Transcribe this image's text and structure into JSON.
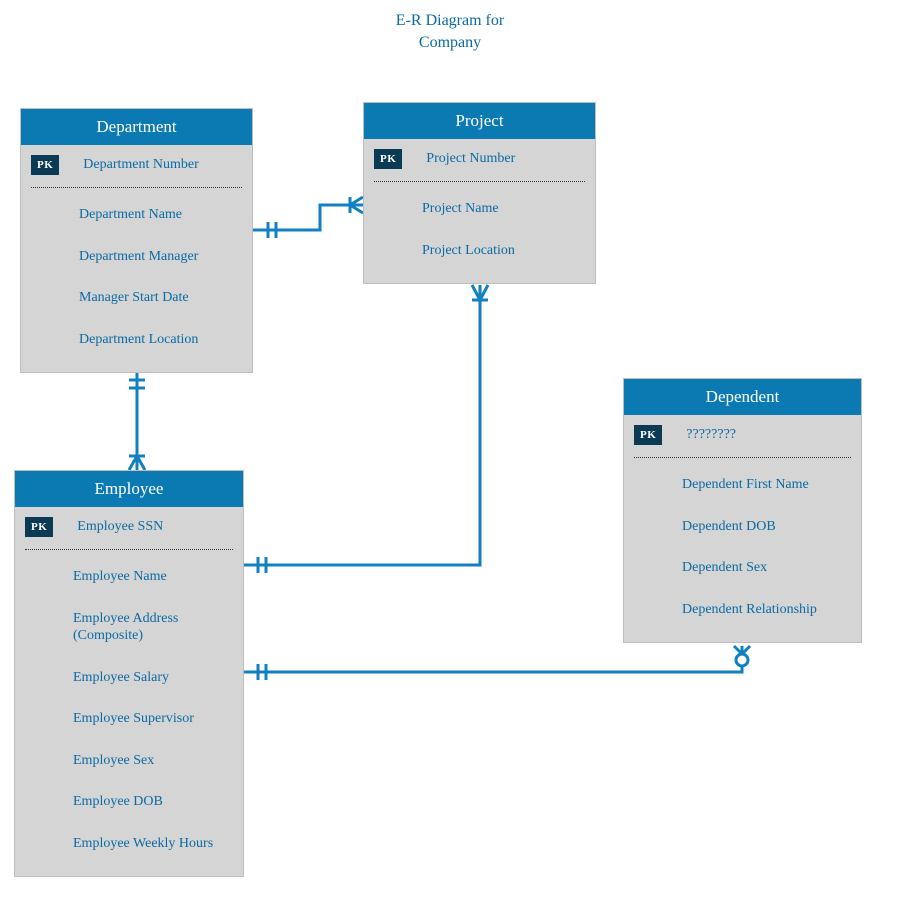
{
  "title_line1": "E-R Diagram for",
  "title_line2": "Company",
  "pk_label": "PK",
  "entities": {
    "department": {
      "name": "Department",
      "pk": "Department Number",
      "attrs": [
        "Department Name",
        "Department Manager",
        "Manager Start Date",
        "Department Location"
      ]
    },
    "project": {
      "name": "Project",
      "pk": "Project Number",
      "attrs": [
        "Project Name",
        "Project Location"
      ]
    },
    "employee": {
      "name": "Employee",
      "pk": "Employee SSN",
      "attrs": [
        "Employee Name",
        "Employee Address (Composite)",
        "Employee Salary",
        "Employee Supervisor",
        "Employee Sex",
        "Employee DOB",
        "Employee Weekly Hours"
      ]
    },
    "dependent": {
      "name": "Dependent",
      "pk": "????????",
      "attrs": [
        "Dependent First Name",
        "Dependent DOB",
        "Dependent Sex",
        "Dependent Relationship"
      ]
    }
  },
  "relationships": [
    {
      "from": "Department",
      "to": "Project",
      "from_card": "one-mandatory",
      "to_card": "many-mandatory"
    },
    {
      "from": "Department",
      "to": "Employee",
      "from_card": "one-mandatory",
      "to_card": "many-mandatory"
    },
    {
      "from": "Employee",
      "to": "Project",
      "from_card": "one-mandatory",
      "to_card": "many-mandatory"
    },
    {
      "from": "Employee",
      "to": "Dependent",
      "from_card": "one-mandatory",
      "to_card": "many-optional"
    }
  ],
  "colors": {
    "accent": "#0b7ab3",
    "line": "#1080c0",
    "text": "#0b6aa3",
    "box": "#d5d5d5",
    "pk_bg": "#0b3a55"
  }
}
